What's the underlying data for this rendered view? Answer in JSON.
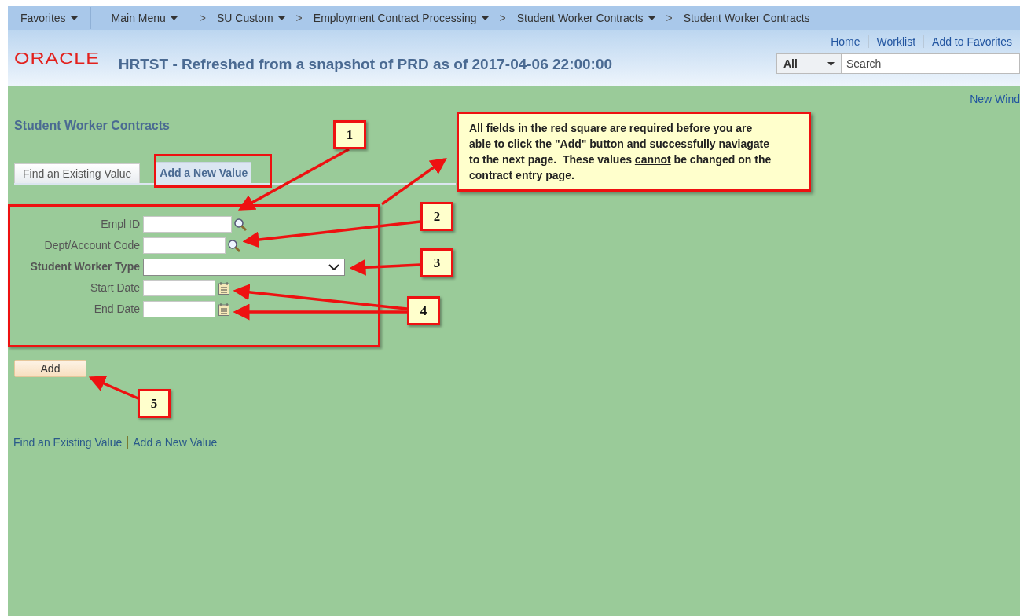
{
  "nav": [
    {
      "label": "Favorites",
      "dropdown": true
    },
    {
      "label": "Main Menu",
      "dropdown": true
    },
    {
      "separator": ">",
      "label": "SU Custom",
      "dropdown": true
    },
    {
      "separator": ">",
      "label": "Employment Contract Processing",
      "dropdown": true
    },
    {
      "separator": ">",
      "label": "Student Worker Contracts",
      "dropdown": true
    },
    {
      "separator": ">",
      "label": "Student Worker Contracts",
      "dropdown": false
    }
  ],
  "header": {
    "logo": "ORACLE",
    "title": "HRTST - Refreshed from a snapshot of PRD as of 2017-04-06 22:00:00",
    "links": [
      "Home",
      "Worklist",
      "Add to Favorites"
    ],
    "search_scope": "All",
    "search_placeholder": "Search"
  },
  "new_window": "New Wind",
  "page_title": "Student Worker Contracts",
  "tabs": [
    {
      "label": "Find an Existing Value",
      "selected": false
    },
    {
      "label": "Add a New Value",
      "selected": true
    }
  ],
  "fields": [
    {
      "label": "Empl ID",
      "kind": "lookup",
      "required": false
    },
    {
      "label": "Dept/Account Code",
      "kind": "lookup",
      "required": false
    },
    {
      "label": "Student Worker Type",
      "kind": "select",
      "required": true
    },
    {
      "label": "Start Date",
      "kind": "date",
      "required": false
    },
    {
      "label": "End Date",
      "kind": "date",
      "required": false
    }
  ],
  "add_button": "Add",
  "bottom_links": [
    "Find an Existing Value",
    "Add a New Value"
  ],
  "callout": [
    {
      "text": "All fields in the red square are required before you are able to click the \"Add\" button and successfully naviagate to the next page.  These values ",
      "underline": false
    },
    {
      "text": "cannot",
      "underline": true
    },
    {
      "text": " be changed on the contract entry page.",
      "underline": false
    }
  ],
  "markers": [
    "1",
    "2",
    "3",
    "4",
    "5"
  ]
}
